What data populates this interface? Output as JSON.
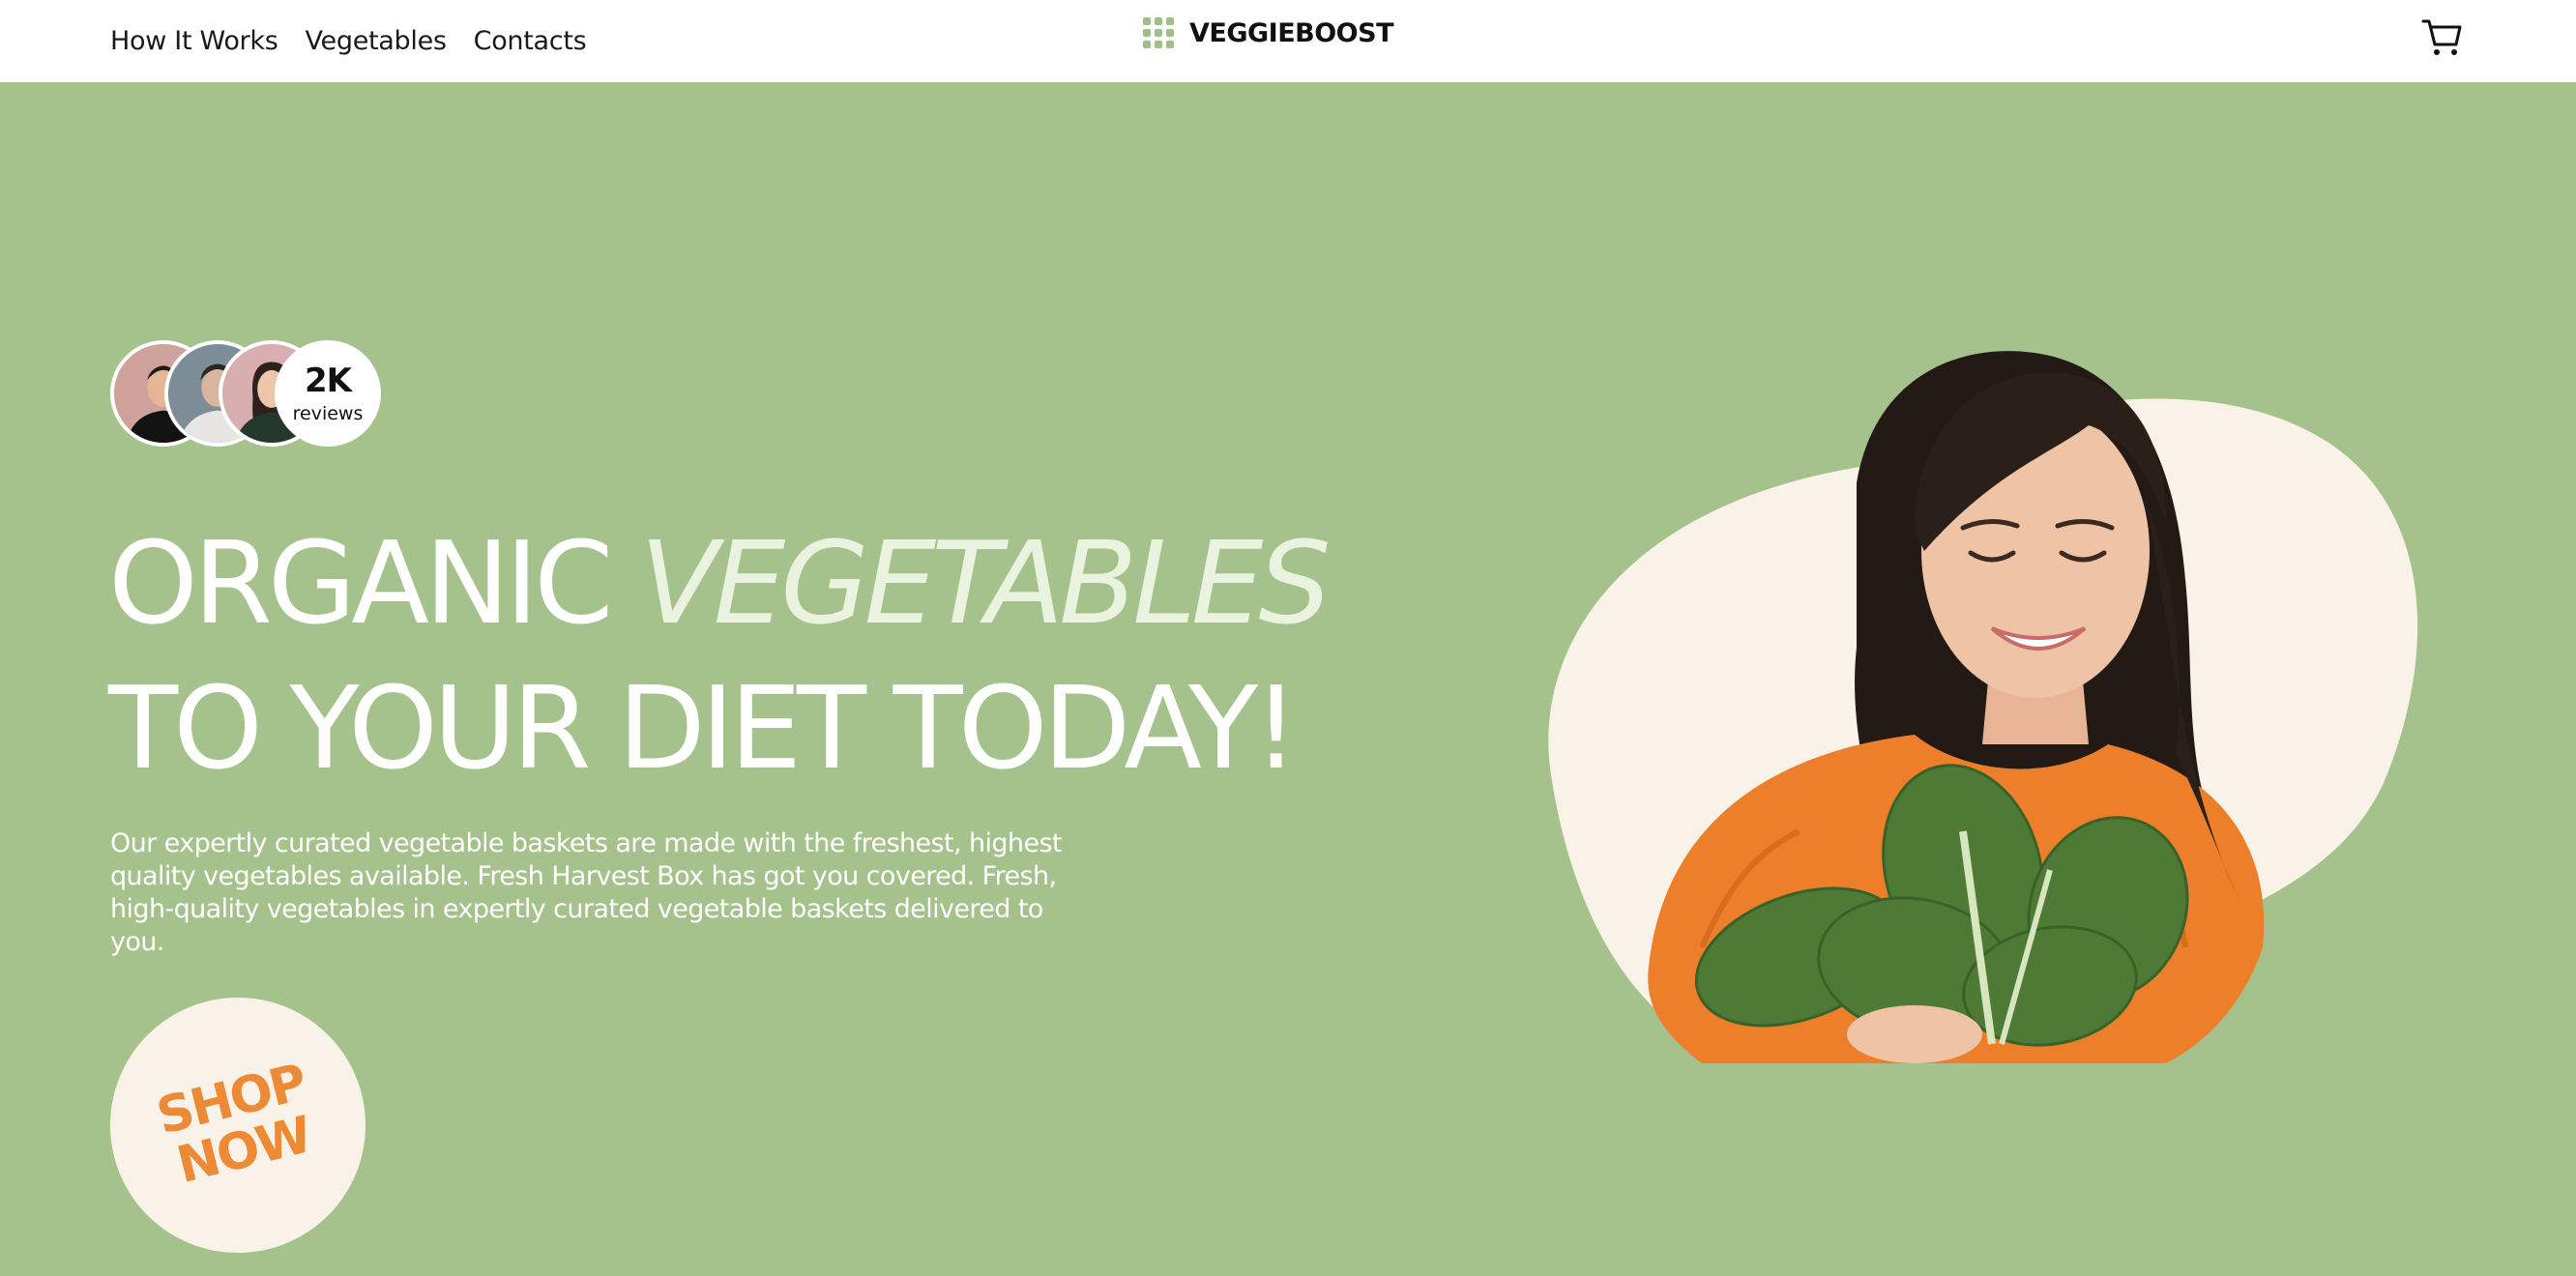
{
  "header": {
    "nav": [
      "How It Works",
      "Vegetables",
      "Contacts"
    ],
    "brand": "VEGGIEBOOST",
    "brand_icon": "grid-dots-icon",
    "cart_icon": "shopping-cart-icon"
  },
  "hero": {
    "reviews": {
      "count": "2K",
      "label": "reviews"
    },
    "headline": {
      "line1_plain": "ORGANIC ",
      "line1_accent": "VEGETABLES",
      "line2": "TO YOUR DIET TODAY!"
    },
    "description": "Our expertly curated vegetable baskets are made with the freshest, highest quality vegetables available. Fresh Harvest Box has got you covered. Fresh, high-quality vegetables in expertly curated vegetable baskets delivered to you.",
    "cta": {
      "line1": "SHOP",
      "line2": "NOW"
    }
  },
  "colors": {
    "background": "#a6c28c",
    "header": "#ffffff",
    "cream": "#f8f2e8",
    "cta_text": "#ec8a36",
    "accent_text": "#e9f3e0",
    "brand_icon": "#9fbf86"
  }
}
